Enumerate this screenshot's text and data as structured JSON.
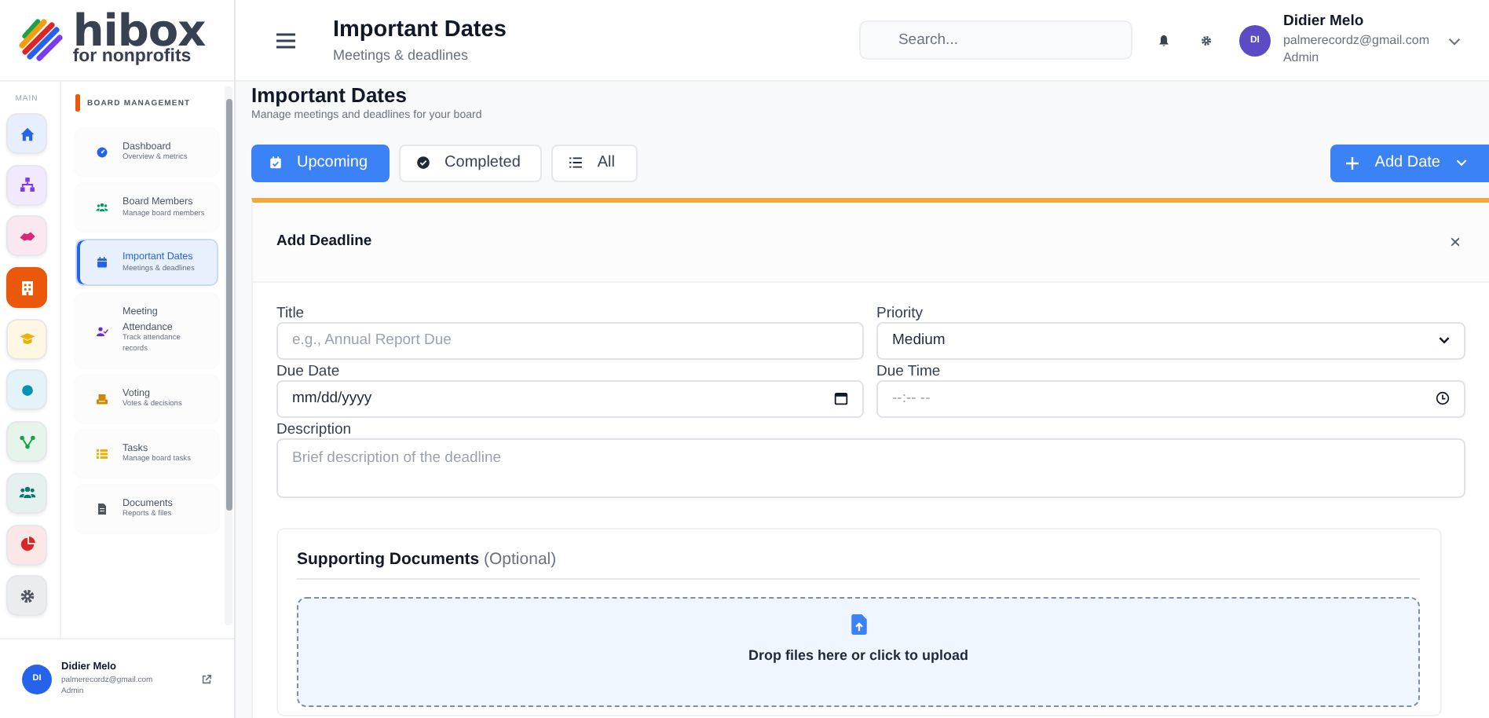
{
  "logo": {
    "name": "hibox",
    "tagline": "for nonprofits"
  },
  "rail": {
    "heading": "MAIN",
    "items": [
      {
        "selected": false,
        "color": "#2563eb"
      },
      {
        "selected": false,
        "color": "#7c3aed"
      },
      {
        "selected": false,
        "color": "#db2777"
      },
      {
        "selected": true,
        "color": "#ea580c"
      },
      {
        "selected": false,
        "color": "#eab308"
      },
      {
        "selected": false,
        "color": "#0891b2"
      },
      {
        "selected": false,
        "color": "#16a34a"
      },
      {
        "selected": false,
        "color": "#0f766e"
      },
      {
        "selected": false,
        "color": "#dc2626"
      },
      {
        "selected": false,
        "color": "#4b5563"
      }
    ]
  },
  "submenu": {
    "heading": "BOARD MANAGEMENT",
    "items": [
      {
        "label": "Dashboard",
        "sub": "Overview & metrics",
        "selected": false,
        "color": "#2563eb"
      },
      {
        "label": "Board Members",
        "sub": "Manage board members",
        "selected": false,
        "color": "#059669"
      },
      {
        "label": "Important Dates",
        "sub": "Meetings & deadlines",
        "selected": true,
        "color": "#2563eb"
      },
      {
        "label": "Meeting Attendance",
        "sub": "Track attendance records",
        "selected": false,
        "color": "#6d28d9"
      },
      {
        "label": "Voting",
        "sub": "Votes & decisions",
        "selected": false,
        "color": "#ca8a04"
      },
      {
        "label": "Tasks",
        "sub": "Manage board tasks",
        "selected": false,
        "color": "#eab308"
      },
      {
        "label": "Documents",
        "sub": "Reports & files",
        "selected": false,
        "color": "#4b5563"
      }
    ]
  },
  "sidebar_user": {
    "initials": "DI",
    "name": "Didier Melo",
    "email": "palmerecordz@gmail.com",
    "role": "Admin"
  },
  "header": {
    "title": "Important Dates",
    "subtitle": "Meetings & deadlines",
    "search": {
      "placeholder": "Search..."
    },
    "user": {
      "initials": "DI",
      "name": "Didier Melo",
      "email": "palmerecordz@gmail.com",
      "role": "Admin"
    }
  },
  "page": {
    "title": "Important Dates",
    "subtitle": "Manage meetings and deadlines for your board",
    "filters": [
      {
        "label": "Upcoming",
        "selected": true
      },
      {
        "label": "Completed",
        "selected": false
      },
      {
        "label": "All",
        "selected": false
      }
    ],
    "add_button": "Add Date"
  },
  "form": {
    "title": "Add Deadline",
    "close": "×",
    "title_field": {
      "label": "Title",
      "placeholder": "e.g., Annual Report Due"
    },
    "priority": {
      "label": "Priority",
      "value": "Medium"
    },
    "due_date": {
      "label": "Due Date",
      "value": "mm/dd/yyyy"
    },
    "due_time": {
      "label": "Due Time",
      "placeholder": "--:-- --"
    },
    "description": {
      "label": "Description",
      "placeholder": "Brief description of the deadline"
    },
    "documents": {
      "title": "**Supporting Documents** (Optional)",
      "upload_text": "Drop files here or click to upload"
    }
  }
}
